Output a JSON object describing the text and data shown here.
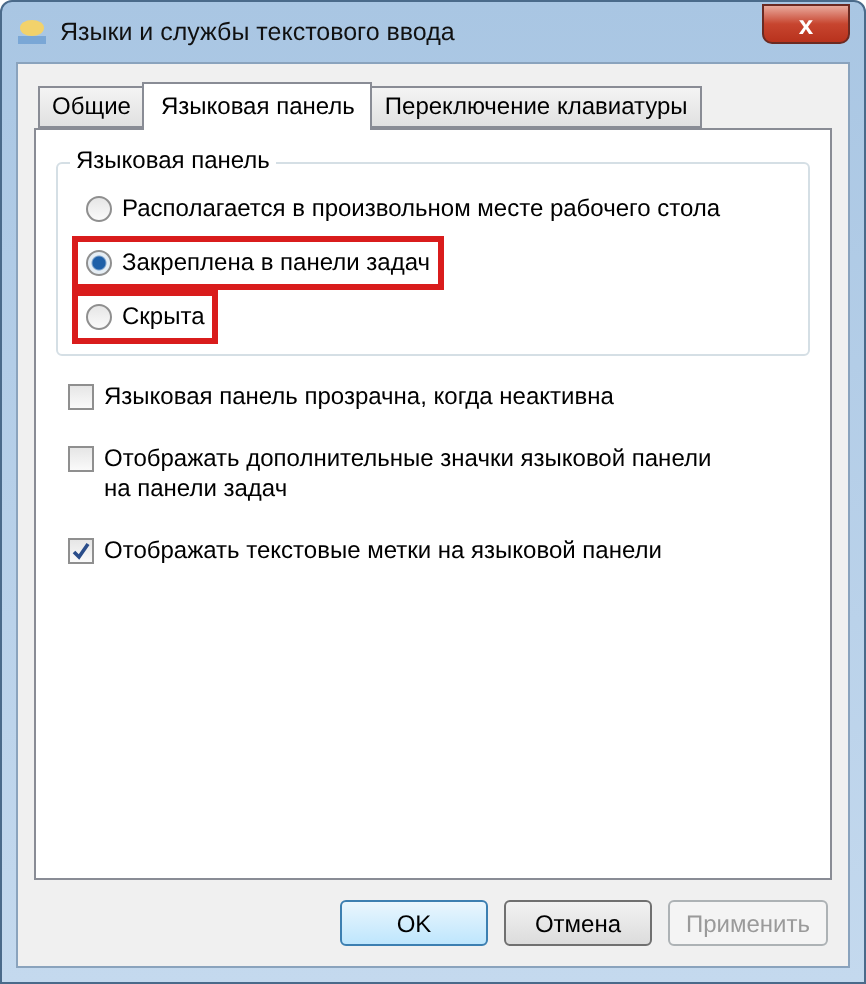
{
  "window": {
    "title": "Языки и службы текстового ввода",
    "close": "x"
  },
  "tabs": [
    {
      "label": "Общие",
      "selected": false,
      "highlighted": false
    },
    {
      "label": "Языковая панель",
      "selected": true,
      "highlighted": false
    },
    {
      "label": "Переключение клавиатуры",
      "selected": false,
      "highlighted": false
    }
  ],
  "group": {
    "title": "Языковая панель",
    "options": [
      {
        "label": "Располагается в произвольном месте рабочего стола",
        "selected": false,
        "highlighted": false
      },
      {
        "label": "Закреплена в панели задач",
        "selected": true,
        "highlighted": true
      },
      {
        "label": "Скрыта",
        "selected": false,
        "highlighted": true
      }
    ]
  },
  "checkboxes": [
    {
      "label": "Языковая панель прозрачна, когда неактивна",
      "checked": false
    },
    {
      "label": "Отображать дополнительные значки языковой панели на панели задач",
      "checked": false
    },
    {
      "label": "Отображать текстовые метки на языковой панели",
      "checked": true
    }
  ],
  "buttons": [
    {
      "label": "OK",
      "default": true,
      "disabled": false
    },
    {
      "label": "Отмена",
      "default": false,
      "disabled": false
    },
    {
      "label": "Применить",
      "default": false,
      "disabled": true
    }
  ]
}
